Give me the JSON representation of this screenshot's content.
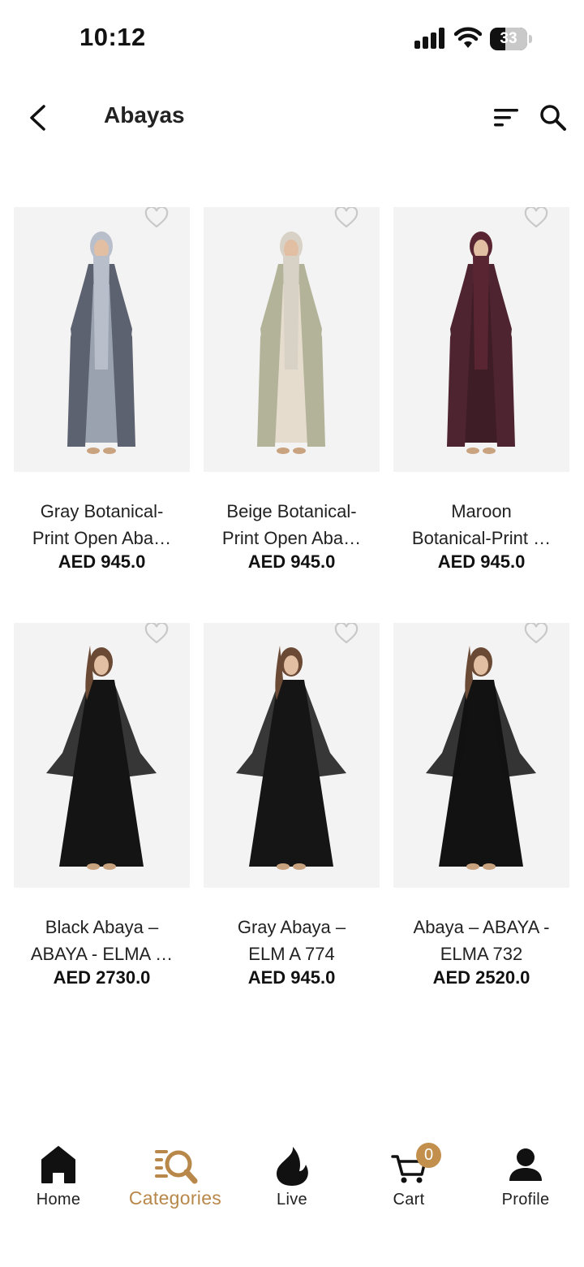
{
  "status_bar": {
    "time": "10:12",
    "battery": "33"
  },
  "header": {
    "title": "Abayas",
    "back_icon": "chevron-left-icon",
    "sort_icon": "sort-icon",
    "search_icon": "search-icon"
  },
  "products": [
    {
      "name_line1": "Gray Botanical-",
      "name_line2": "Print Open Aba…",
      "price": "AED 945.0",
      "robe_color": "#5d6270",
      "scarf_color": "#b9bfca",
      "inner_color": "#9aa2b0"
    },
    {
      "name_line1": "Beige Botanical-",
      "name_line2": "Print Open Aba…",
      "price": "AED 945.0",
      "robe_color": "#b3b39a",
      "scarf_color": "#d8d1c6",
      "inner_color": "#e6dccd"
    },
    {
      "name_line1": "Maroon",
      "name_line2": "Botanical-Print …",
      "price": "AED 945.0",
      "robe_color": "#4e2430",
      "scarf_color": "#5a2533",
      "inner_color": "#3e1d26"
    },
    {
      "name_line1": "Black Abaya –",
      "name_line2": "ABAYA - ELMA …",
      "price": "AED 2730.0",
      "robe_color": "#141414",
      "scarf_color": "#141414",
      "inner_color": "#222222"
    },
    {
      "name_line1": "Gray Abaya –",
      "name_line2": "ELM A 774",
      "price": "AED 945.0",
      "robe_color": "#151515",
      "scarf_color": "#151515",
      "inner_color": "#262626"
    },
    {
      "name_line1": "Abaya – ABAYA -",
      "name_line2": "ELMA 732",
      "price": "AED 2520.0",
      "robe_color": "#121212",
      "scarf_color": "#121212",
      "inner_color": "#242424"
    }
  ],
  "tabs": [
    {
      "label": "Home",
      "icon": "home-icon"
    },
    {
      "label": "Categories",
      "icon": "categories-search-icon"
    },
    {
      "label": "Live",
      "icon": "flame-icon"
    },
    {
      "label": "Cart",
      "icon": "cart-icon"
    },
    {
      "label": "Profile",
      "icon": "profile-icon"
    }
  ],
  "active_tab": "Categories",
  "cart_count": "0",
  "colors": {
    "accent": "#b8874a",
    "badge": "#c28f4d"
  }
}
